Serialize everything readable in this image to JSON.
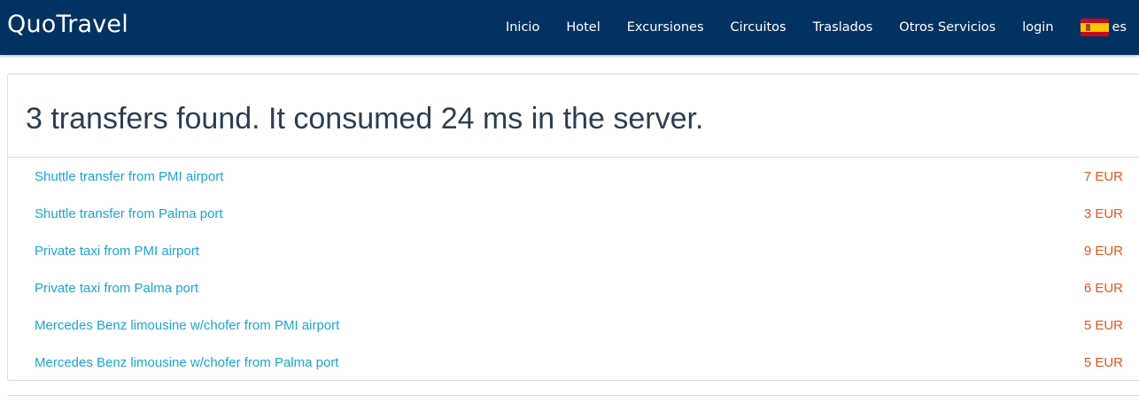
{
  "navbar": {
    "brand": "QuoTravel",
    "items": [
      {
        "label": "Inicio"
      },
      {
        "label": "Hotel"
      },
      {
        "label": "Excursiones"
      },
      {
        "label": "Circuitos"
      },
      {
        "label": "Traslados"
      },
      {
        "label": "Otros Servicios"
      },
      {
        "label": "login"
      }
    ],
    "language": {
      "code": "es",
      "icon": "spain-flag-icon"
    },
    "background_color": "#033262"
  },
  "results": {
    "title": "3 transfers found. It consumed 24 ms in the server.",
    "items": [
      {
        "name": "Shuttle transfer from PMI airport",
        "price": "7 EUR"
      },
      {
        "name": "Shuttle transfer from Palma port",
        "price": "3 EUR"
      },
      {
        "name": "Private taxi from PMI airport",
        "price": "9 EUR"
      },
      {
        "name": "Private taxi from Palma port",
        "price": "6 EUR"
      },
      {
        "name": "Mercedes Benz limousine w/chofer from PMI airport",
        "price": "5 EUR"
      },
      {
        "name": "Mercedes Benz limousine w/chofer from Palma port",
        "price": "5 EUR"
      }
    ],
    "link_color": "#1ba5d8",
    "price_color": "#e9541f"
  }
}
